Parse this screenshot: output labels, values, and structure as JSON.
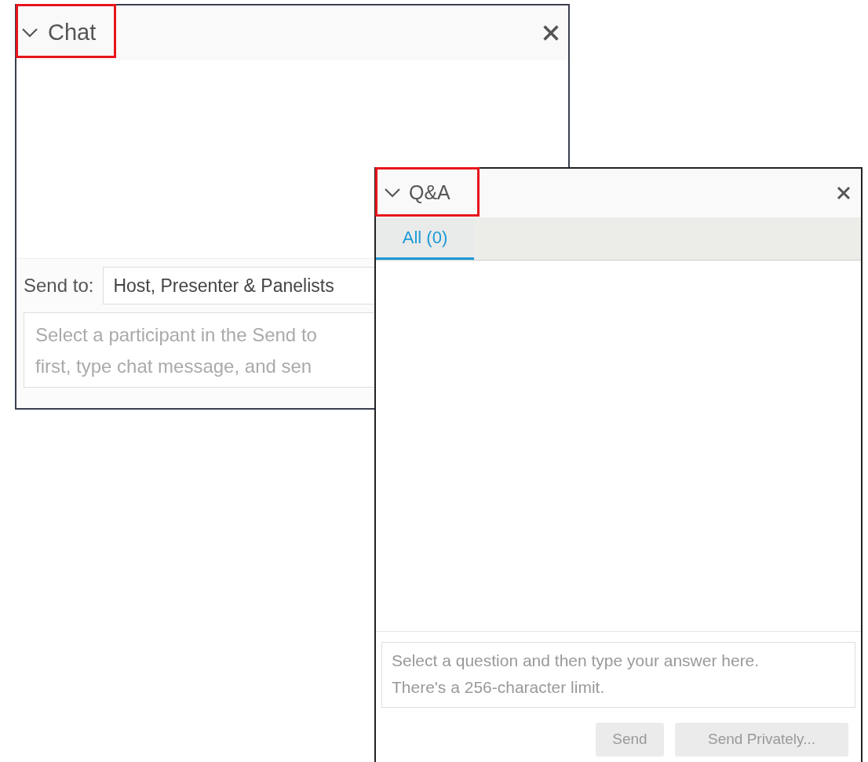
{
  "chat": {
    "title": "Chat",
    "send_to_label": "Send to:",
    "send_to_value": "Host, Presenter & Panelists",
    "message_placeholder": "Select a participant in the Send to\nfirst, type chat message, and sen"
  },
  "qa": {
    "title": "Q&A",
    "tabs": [
      {
        "label": "All (0)",
        "selected": true
      }
    ],
    "answer_placeholder": "Select a question and then type your answer here.\nThere's a 256-character limit.",
    "buttons": [
      {
        "label": "Send",
        "disabled": true
      },
      {
        "label": "Send Privately...",
        "disabled": true
      }
    ]
  }
}
